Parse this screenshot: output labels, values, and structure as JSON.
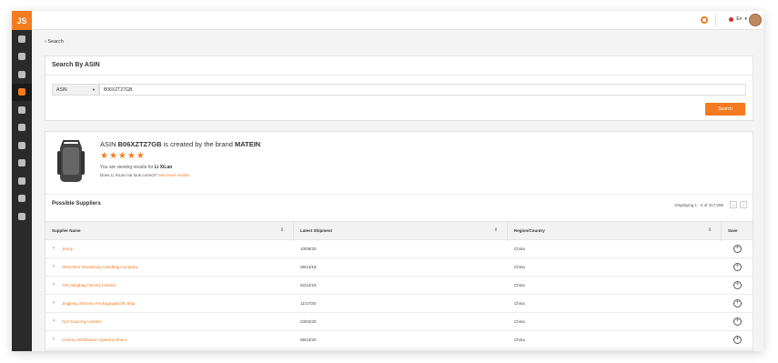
{
  "app": {
    "logo": "JS",
    "language": "En",
    "accent": "#f47b20"
  },
  "sidebar": {
    "items": [
      {
        "icon": "home-icon"
      },
      {
        "icon": "headset-icon"
      },
      {
        "icon": "search-icon"
      },
      {
        "icon": "supplier-icon",
        "active": true
      },
      {
        "icon": "tools-icon"
      },
      {
        "icon": "megaphone-icon"
      },
      {
        "icon": "bar-chart-icon"
      },
      {
        "icon": "keyboard-icon"
      },
      {
        "icon": "layers-icon"
      },
      {
        "icon": "graduation-cap-icon"
      },
      {
        "icon": "globe-icon"
      }
    ]
  },
  "breadcrumb": {
    "back_label": "Search"
  },
  "search_card": {
    "title": "Search By ASIN",
    "select_value": "ASIN",
    "input_value": "B06XZTZ7GB",
    "button_label": "Search"
  },
  "product": {
    "prefix": "ASIN",
    "asin": "B06XZTZ7GB",
    "middle": "is created by the brand",
    "brand": "MATEIN",
    "stars": "★★★★★",
    "viewing_text": "You are viewing results for",
    "viewing_name": "Li XiLan",
    "not_correct_text": "Does Li XiLan not look correct?",
    "see_more": "See more results"
  },
  "suppliers": {
    "title": "Possible Suppliers",
    "displaying": "Displaying 1 - 5 of 317,098",
    "prev": "‹",
    "next": "›",
    "columns": [
      "Supplier Name",
      "Latest Shipment",
      "Region/Country",
      "Save"
    ],
    "rows": [
      {
        "name": "Jenny",
        "shipment": "10/05/20",
        "region": "China"
      },
      {
        "name": "Shenzhen Shuaishing Handbag Company",
        "shipment": "09/14/19",
        "region": "China"
      },
      {
        "name": "Yeli Hangbag Factory Limited",
        "shipment": "02/12/19",
        "region": "China"
      },
      {
        "name": "Jingjiang Shmanu Packaging&Gifts Bxqi",
        "shipment": "11/17/20",
        "region": "China"
      },
      {
        "name": "Cjet Sourcing Limited",
        "shipment": "03/03/20",
        "region": "China"
      },
      {
        "name": "Century Distribution Systems Shenz",
        "shipment": "06/10/20",
        "region": "China"
      }
    ]
  }
}
